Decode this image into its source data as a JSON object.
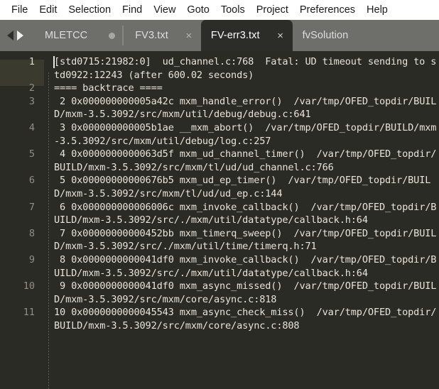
{
  "menubar": {
    "items": [
      {
        "label": "File"
      },
      {
        "label": "Edit"
      },
      {
        "label": "Selection"
      },
      {
        "label": "Find"
      },
      {
        "label": "View"
      },
      {
        "label": "Goto"
      },
      {
        "label": "Tools"
      },
      {
        "label": "Project"
      },
      {
        "label": "Preferences"
      },
      {
        "label": "Help"
      }
    ]
  },
  "tabbar": {
    "nav_prev_icon": "arrow-left-icon",
    "nav_next_icon": "arrow-right-icon",
    "tabs": [
      {
        "label": "MLETCC",
        "active": false,
        "close": "",
        "dot": true
      },
      {
        "label": "FV3.txt",
        "active": false,
        "close": "×",
        "dot": false
      },
      {
        "label": "FV-err3.txt",
        "active": true,
        "close": "×",
        "dot": false
      },
      {
        "label": "fvSolution",
        "active": false,
        "close": "",
        "dot": false
      }
    ]
  },
  "editor": {
    "active_line": 1,
    "gutter": [
      "1",
      "2",
      "3",
      "4",
      "5",
      "6",
      "7",
      "8",
      "9",
      "10",
      "11"
    ],
    "lines": [
      "[std0715:21982:0]  ud_channel.c:768  Fatal: UD timeout sending to std0922:12243 (after 600.02 seconds)",
      "==== backtrace ====",
      " 2 0x000000000005a42c mxm_handle_error()  /var/tmp/OFED_topdir/BUILD/mxm-3.5.3092/src/mxm/util/debug/debug.c:641",
      " 3 0x000000000005b1ae __mxm_abort()  /var/tmp/OFED_topdir/BUILD/mxm-3.5.3092/src/mxm/util/debug/log.c:257",
      " 4 0x0000000000063d5f mxm_ud_channel_timer()  /var/tmp/OFED_topdir/BUILD/mxm-3.5.3092/src/mxm/tl/ud/ud_channel.c:766",
      " 5 0x00000000000676b5 mxm_ud_ep_timer()  /var/tmp/OFED_topdir/BUILD/mxm-3.5.3092/src/mxm/tl/ud/ud_ep.c:144",
      " 6 0x000000000006006c mxm_invoke_callback()  /var/tmp/OFED_topdir/BUILD/mxm-3.5.3092/src/./mxm/util/datatype/callback.h:64",
      " 7 0x00000000000452bb mxm_timerq_sweep()  /var/tmp/OFED_topdir/BUILD/mxm-3.5.3092/src/./mxm/util/time/timerq.h:71",
      " 8 0x0000000000041df0 mxm_invoke_callback()  /var/tmp/OFED_topdir/BUILD/mxm-3.5.3092/src/./mxm/util/datatype/callback.h:64",
      " 9 0x0000000000041df0 mxm_async_missed()  /var/tmp/OFED_topdir/BUILD/mxm-3.5.3092/src/mxm/core/async.c:818",
      "10 0x0000000000045543 mxm_async_check_miss()  /var/tmp/OFED_topdir/BUILD/mxm-3.5.3092/src/mxm/core/async.c:808"
    ]
  },
  "colors": {
    "menubar_bg": "#ffffff",
    "tabbar_bg": "#6e6e6b",
    "active_tab_bg": "#2c2c28",
    "editor_bg": "#2b2b26",
    "text": "#e6e3d8",
    "gutter_text": "#918f84",
    "active_line_bg": "#3b3a2e"
  }
}
